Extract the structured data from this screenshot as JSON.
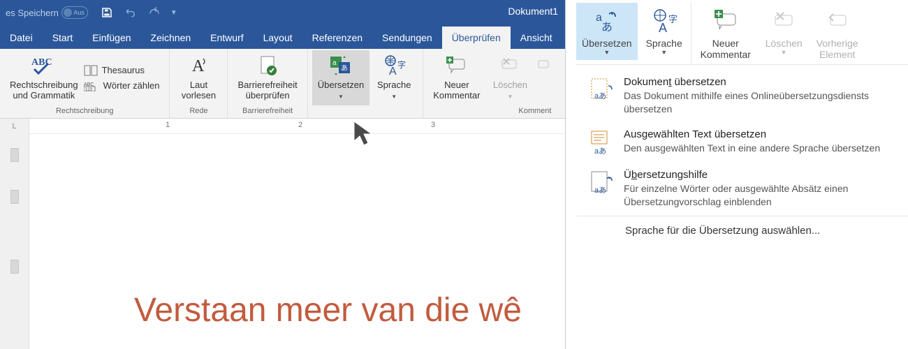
{
  "titlebar": {
    "autosave_label": "es Speichern",
    "toggle_state": "Aus",
    "document_title": "Dokument1"
  },
  "tabs": [
    {
      "label": "Datei"
    },
    {
      "label": "Start"
    },
    {
      "label": "Einfügen"
    },
    {
      "label": "Zeichnen"
    },
    {
      "label": "Entwurf"
    },
    {
      "label": "Layout"
    },
    {
      "label": "Referenzen"
    },
    {
      "label": "Sendungen"
    },
    {
      "label": "Überprüfen",
      "active": true
    },
    {
      "label": "Ansicht"
    }
  ],
  "ribbon": {
    "proofing": {
      "spell_line1": "Rechtschreibung",
      "spell_line2": "und Grammatik",
      "thesaurus": "Thesaurus",
      "wordcount": "Wörter zählen",
      "group_label": "Rechtschreibung"
    },
    "speech": {
      "read_line1": "Laut",
      "read_line2": "vorlesen",
      "group_label": "Rede"
    },
    "accessibility": {
      "line1": "Barrierefreiheit",
      "line2": "überprüfen",
      "group_label": "Barrierefreiheit"
    },
    "language": {
      "translate": "Übersetzen",
      "language": "Sprache"
    },
    "comments": {
      "new_line1": "Neuer",
      "new_line2": "Kommentar",
      "delete": "Löschen",
      "group_label": "Komment"
    }
  },
  "ruler": {
    "gutter": "L",
    "n1": "1",
    "n2": "2",
    "n3": "3"
  },
  "document": {
    "heading": "Verstaan meer van die wê"
  },
  "popup": {
    "mini": {
      "translate": "Übersetzen",
      "language": "Sprache",
      "new_line1": "Neuer",
      "new_line2": "Kommentar",
      "delete": "Löschen",
      "prev_line1": "Vorherige",
      "prev_line2": "Element"
    },
    "items": [
      {
        "title_pre": "Dokumen",
        "title_accel": "t",
        "title_post": " übersetzen",
        "desc": "Das Dokument mithilfe eines Onlineübersetzungsdiensts übersetzen"
      },
      {
        "title_pre": "Aus",
        "title_accel": "g",
        "title_post": "ewählten Text übersetzen",
        "desc": "Den ausgewählten Text in eine andere Sprache übersetzen"
      },
      {
        "title_pre": "Ü",
        "title_accel": "b",
        "title_post": "ersetzungshilfe",
        "desc": "Für einzelne Wörter oder ausgewählte Absätz einen Übersetzungvorschlag einblenden"
      }
    ],
    "footer": "Sprache für die Übersetzung auswählen..."
  }
}
